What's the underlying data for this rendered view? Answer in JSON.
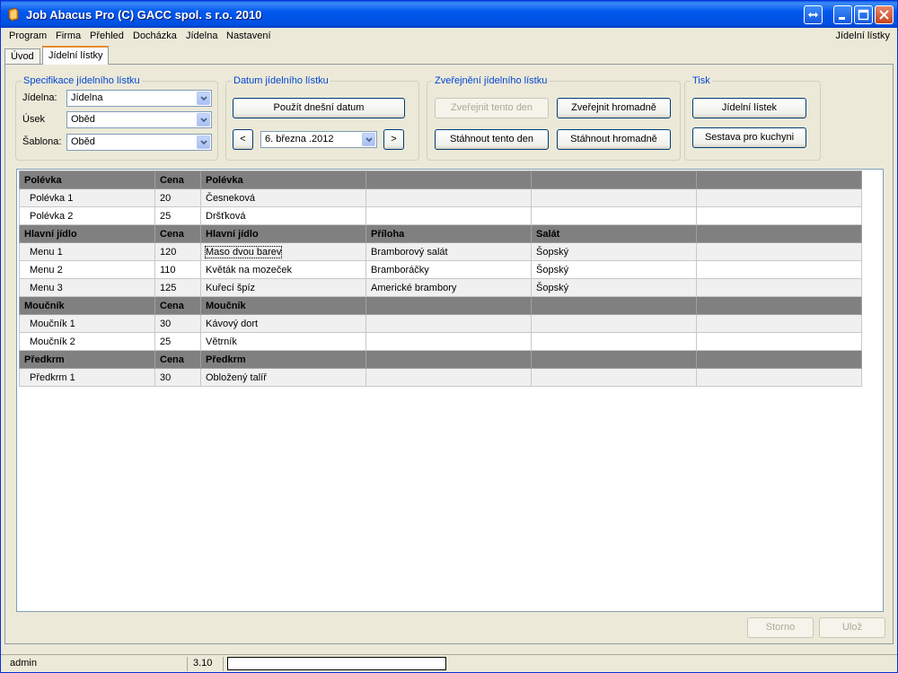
{
  "window": {
    "title": "Job Abacus Pro (C) GACC spol. s r.o. 2010"
  },
  "menubar": {
    "items": [
      {
        "label": "Program"
      },
      {
        "label": "Firma"
      },
      {
        "label": "Přehled"
      },
      {
        "label": "Docházka"
      },
      {
        "label": "Jídelna"
      },
      {
        "label": "Nastavení"
      }
    ],
    "right_label": "Jídelní lístky"
  },
  "tabs": [
    {
      "label": "Úvod",
      "active": false
    },
    {
      "label": "Jídelní lístky",
      "active": true
    }
  ],
  "spec": {
    "legend": "Specifikace jídelního lístku",
    "jidelna_label": "Jídelna:",
    "jidelna_value": "Jídelna",
    "usek_label": "Úsek",
    "usek_value": "Oběd",
    "sablona_label": "Šablona:",
    "sablona_value": "Oběd"
  },
  "datum": {
    "legend": "Datum jídelního lístku",
    "today_button": "Použít dnešní datum",
    "prev": "<",
    "next": ">",
    "date_value": "6.  března  .2012"
  },
  "publish": {
    "legend": "Zveřejnění jídelního lístku",
    "publish_day": "Zveřejnit tento den",
    "publish_bulk": "Zveřejnit hromadně",
    "withdraw_day": "Stáhnout tento den",
    "withdraw_bulk": "Stáhnout hromadně"
  },
  "print": {
    "legend": "Tisk",
    "menu_button": "Jídelní lístek",
    "kitchen_button": "Sestava pro kuchyni"
  },
  "grid": {
    "rows": [
      {
        "kind": "cat",
        "cells": [
          "Polévka",
          "Cena",
          "Polévka",
          "",
          "",
          ""
        ]
      },
      {
        "kind": "row",
        "cells": [
          "Polévka 1",
          "20",
          "Česneková",
          "",
          "",
          ""
        ]
      },
      {
        "kind": "row",
        "cells": [
          "Polévka 2",
          "25",
          "Dršťková",
          "",
          "",
          ""
        ]
      },
      {
        "kind": "cat",
        "cells": [
          "Hlavní jídlo",
          "Cena",
          "Hlavní jídlo",
          "Příloha",
          "Salát",
          ""
        ]
      },
      {
        "kind": "row",
        "cells": [
          "Menu 1",
          "120",
          "Maso dvou barev",
          "Bramborový salát",
          "Šopský",
          ""
        ],
        "focus": 2
      },
      {
        "kind": "row",
        "cells": [
          "Menu 2",
          "110",
          "Květák na mozeček",
          "Bramboráčky",
          "Šopský",
          ""
        ]
      },
      {
        "kind": "row",
        "cells": [
          "Menu 3",
          "125",
          "Kuřecí špíz",
          "Americké brambory",
          "Šopský",
          ""
        ]
      },
      {
        "kind": "cat",
        "cells": [
          "Moučník",
          "Cena",
          "Moučník",
          "",
          "",
          ""
        ]
      },
      {
        "kind": "row",
        "cells": [
          "Moučník 1",
          "30",
          "Kávový dort",
          "",
          "",
          ""
        ]
      },
      {
        "kind": "row",
        "cells": [
          "Moučník 2",
          "25",
          "Větrník",
          "",
          "",
          ""
        ]
      },
      {
        "kind": "cat",
        "cells": [
          "Předkrm",
          "Cena",
          "Předkrm",
          "",
          "",
          ""
        ]
      },
      {
        "kind": "row",
        "cells": [
          "Předkrm 1",
          "30",
          "Obložený talíř",
          "",
          "",
          ""
        ]
      }
    ]
  },
  "actions": {
    "storno": "Storno",
    "uloz": "Ulož"
  },
  "status": {
    "user": "admin",
    "version": "3.10"
  },
  "colors": {
    "titlebar": "#0058ee",
    "accent_tab": "#e68b2c",
    "legend": "#0046d5",
    "category_row": "#808080"
  }
}
